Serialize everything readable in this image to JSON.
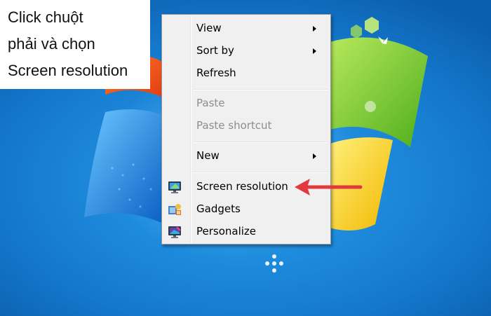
{
  "caption": {
    "line1": "Click chuột",
    "line2": "phải và chọn",
    "line3": "Screen resolution"
  },
  "context_menu": {
    "items": [
      {
        "label": "View",
        "submenu": true,
        "enabled": true
      },
      {
        "label": "Sort by",
        "submenu": true,
        "enabled": true
      },
      {
        "label": "Refresh",
        "submenu": false,
        "enabled": true
      },
      {
        "label": "Paste",
        "submenu": false,
        "enabled": false
      },
      {
        "label": "Paste shortcut",
        "submenu": false,
        "enabled": false
      },
      {
        "label": "New",
        "submenu": true,
        "enabled": true
      },
      {
        "label": "Screen resolution",
        "submenu": false,
        "enabled": true,
        "icon": "monitor-icon"
      },
      {
        "label": "Gadgets",
        "submenu": false,
        "enabled": true,
        "icon": "gadgets-icon"
      },
      {
        "label": "Personalize",
        "submenu": false,
        "enabled": true,
        "icon": "personalize-icon"
      }
    ]
  },
  "colors": {
    "desktop": "#1c86d9",
    "menu_bg": "#f0f0f0",
    "arrow": "#e03a3e"
  }
}
